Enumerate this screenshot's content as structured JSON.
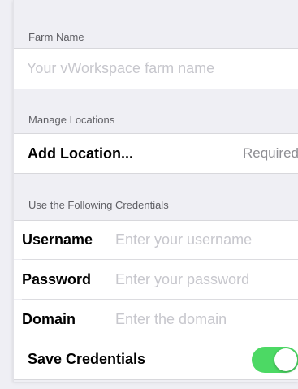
{
  "farm": {
    "header": "Farm Name",
    "placeholder": "Your vWorkspace farm name"
  },
  "locations": {
    "header": "Manage Locations",
    "add_label": "Add Location...",
    "required_text": "Required"
  },
  "credentials": {
    "header": "Use the Following Credentials",
    "username_label": "Username",
    "username_placeholder": "Enter your username",
    "password_label": "Password",
    "password_placeholder": "Enter your password",
    "domain_label": "Domain",
    "domain_placeholder": "Enter the domain",
    "save_label": "Save Credentials",
    "save_enabled": true
  },
  "colors": {
    "toggle_on": "#4cd964",
    "background": "#efeff4"
  }
}
